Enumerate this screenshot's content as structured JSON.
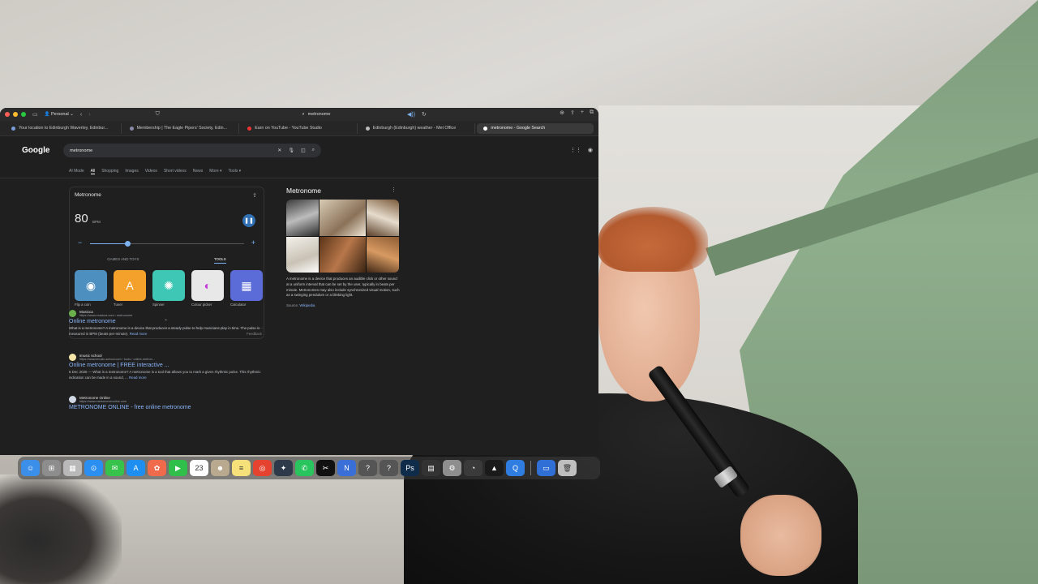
{
  "browser": {
    "profile": "Personal",
    "address": "metronome",
    "tabs": [
      {
        "label": "Your location to Edinburgh Waverley, Edinbur...",
        "active": false
      },
      {
        "label": "Membership | The Eagle Pipers' Society, Edin...",
        "active": false
      },
      {
        "label": "Earn on YouTube - YouTube Studio",
        "active": false
      },
      {
        "label": "Edinburgh (Edinburgh) weather - Met Office",
        "active": false
      },
      {
        "label": "metronome - Google Search",
        "active": true
      }
    ]
  },
  "google": {
    "logo": "Google",
    "query": "metronome",
    "nav_tabs": [
      "AI Mode",
      "All",
      "Shopping",
      "Images",
      "Videos",
      "Short videos",
      "News",
      "More ▾",
      "Tools ▾"
    ],
    "active_nav": "All",
    "metronome_widget": {
      "title": "Metronome",
      "bpm": "80",
      "bpm_unit": "BPM",
      "bpm_fraction": 0.24,
      "tool_tabs": [
        "GAMES AND TOYS",
        "TOOLS"
      ],
      "active_tool_tab": "TOOLS",
      "tools": [
        {
          "label": "Flip a coin",
          "icon": "coin-icon",
          "color": "#4d8fbf",
          "glyph": "◉"
        },
        {
          "label": "Tuner",
          "icon": "tuner-icon",
          "color": "#f4a12b",
          "glyph": "A"
        },
        {
          "label": "Spinner",
          "icon": "spinner-icon",
          "color": "#3ec7b4",
          "glyph": "✺"
        },
        {
          "label": "Colour picker",
          "icon": "colour-picker-icon",
          "color": "#e8e8e8",
          "glyph": "◐"
        },
        {
          "label": "Calculator",
          "icon": "calculator-icon",
          "color": "#5b6bd8",
          "glyph": "▦"
        }
      ],
      "feedback": "Feedback"
    },
    "knowledge_panel": {
      "title": "Metronome",
      "description": "A metronome is a device that produces an audible click or other sound at a uniform interval that can be set by the user, typically in beats per minute. Metronomes may also include synchronized visual motion, such as a swinging pendulum or a blinking light.",
      "source_label": "Source:",
      "source_name": "Wikipedia"
    },
    "results": [
      {
        "site_name": "Musicca",
        "url": "https://www.musicca.com › metronome",
        "title": "Online metronome",
        "snippet": "What is a metronome? A metronome is a device that produces a steady pulse to help musicians play in time. The pulse is measured in BPM (beats-per-minute).",
        "read_more": "Read more",
        "fav_color": "#6ab04c"
      },
      {
        "site_name": "imusic school",
        "url": "https://www.imusic-school.com › tools › online-metron...",
        "title": "Online metronome | FREE interactive ...",
        "snippet": "6 Dec 2025 — What is a metronome? A metronome is a tool that allows you to mark a given rhythmic pulse. This rhythmic indication can be made in a sound, ...",
        "read_more": "Read more",
        "fav_color": "#f5e6a8"
      },
      {
        "site_name": "Metronome Online",
        "url": "https://www.metronomeonline.com",
        "title": "METRONOME ONLINE - free online metronome",
        "snippet": "",
        "read_more": "",
        "fav_color": "#cfd8e3"
      }
    ]
  },
  "dock": {
    "calendar_day": "23",
    "apps": [
      {
        "icon": "finder-icon",
        "color": "#3b8fe8",
        "glyph": "☺"
      },
      {
        "icon": "launchpad-icon",
        "color": "#8d8d8d",
        "glyph": "⊞"
      },
      {
        "icon": "apps-grid-icon",
        "color": "#b9b9b9",
        "glyph": "▦"
      },
      {
        "icon": "safari-icon",
        "color": "#2a8ff0",
        "glyph": "⊙"
      },
      {
        "icon": "messages-icon",
        "color": "#37c24b",
        "glyph": "✉"
      },
      {
        "icon": "app-store-icon",
        "color": "#1f8ef1",
        "glyph": "A"
      },
      {
        "icon": "photos-icon",
        "color": "#f06a4c",
        "glyph": "✿"
      },
      {
        "icon": "facetime-icon",
        "color": "#2fbf4a",
        "glyph": "▶"
      },
      {
        "icon": "calendar-icon",
        "color": "#ffffff",
        "glyph": "23"
      },
      {
        "icon": "contacts-icon",
        "color": "#b8a98f",
        "glyph": "☻"
      },
      {
        "icon": "notes-icon",
        "color": "#f5e07a",
        "glyph": "≡"
      },
      {
        "icon": "chrome-icon",
        "color": "#e5432f",
        "glyph": "◎"
      },
      {
        "icon": "davinci-icon",
        "color": "#2e3a4a",
        "glyph": "✦"
      },
      {
        "icon": "whatsapp-icon",
        "color": "#29c45d",
        "glyph": "✆"
      },
      {
        "icon": "capcut-icon",
        "color": "#111111",
        "glyph": "✂"
      },
      {
        "icon": "notion-icon",
        "color": "#3a6fd8",
        "glyph": "N"
      },
      {
        "icon": "help-icon",
        "color": "#555555",
        "glyph": "?"
      },
      {
        "icon": "help-icon-2",
        "color": "#555555",
        "glyph": "?"
      },
      {
        "icon": "photoshop-icon",
        "color": "#0f2d4a",
        "glyph": "Ps"
      },
      {
        "icon": "claquette-icon",
        "color": "#333333",
        "glyph": "▤"
      },
      {
        "icon": "system-settings-icon",
        "color": "#8e8e8e",
        "glyph": "⚙"
      },
      {
        "icon": "disk-utility-icon",
        "color": "#3a3a3a",
        "glyph": "◔"
      },
      {
        "icon": "arc-icon",
        "color": "#1a1a1a",
        "glyph": "▲"
      },
      {
        "icon": "quicktime-icon",
        "color": "#2f7de0",
        "glyph": "Q"
      },
      {
        "icon": "screen-sharing-icon",
        "color": "#2f6fd6",
        "glyph": "▭"
      },
      {
        "icon": "trash-icon",
        "color": "#bfbfbf",
        "glyph": "🗑"
      }
    ]
  }
}
